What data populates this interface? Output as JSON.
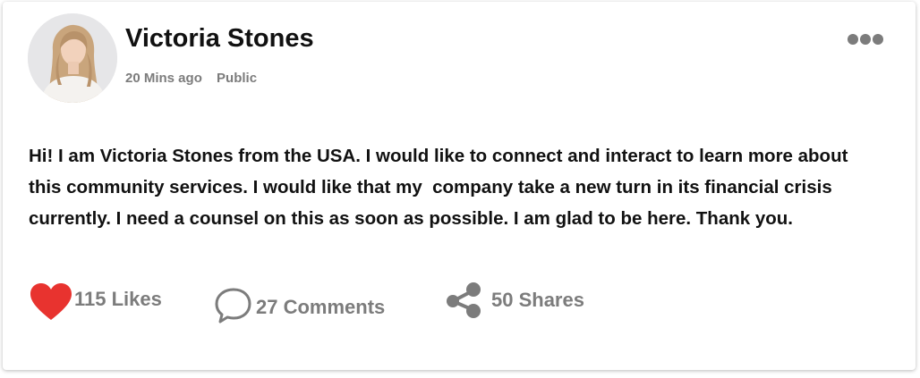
{
  "post": {
    "author": {
      "name": "Victoria Stones",
      "avatar_icon": "user-avatar-photo"
    },
    "time": "20 Mins ago",
    "visibility": "Public",
    "menu_icon": "more-horizontal-icon",
    "text": "Hi! I am Victoria Stones from the USA. I would like to connect and interact to learn more about this community services. I would like that my  company take a new turn in its financial crisis currently. I need a counsel on this as soon as possible. I am glad to be here. Thank you.",
    "actions": {
      "likes": {
        "label": "115 Likes",
        "icon": "heart-icon",
        "color": "#e8332f"
      },
      "comments": {
        "label": "27 Comments",
        "icon": "comment-bubble-icon"
      },
      "shares": {
        "label": "50 Shares",
        "icon": "share-icon"
      }
    }
  },
  "colors": {
    "text_primary": "#111111",
    "text_secondary": "#7c7c7c",
    "like_accent": "#e8332f"
  }
}
